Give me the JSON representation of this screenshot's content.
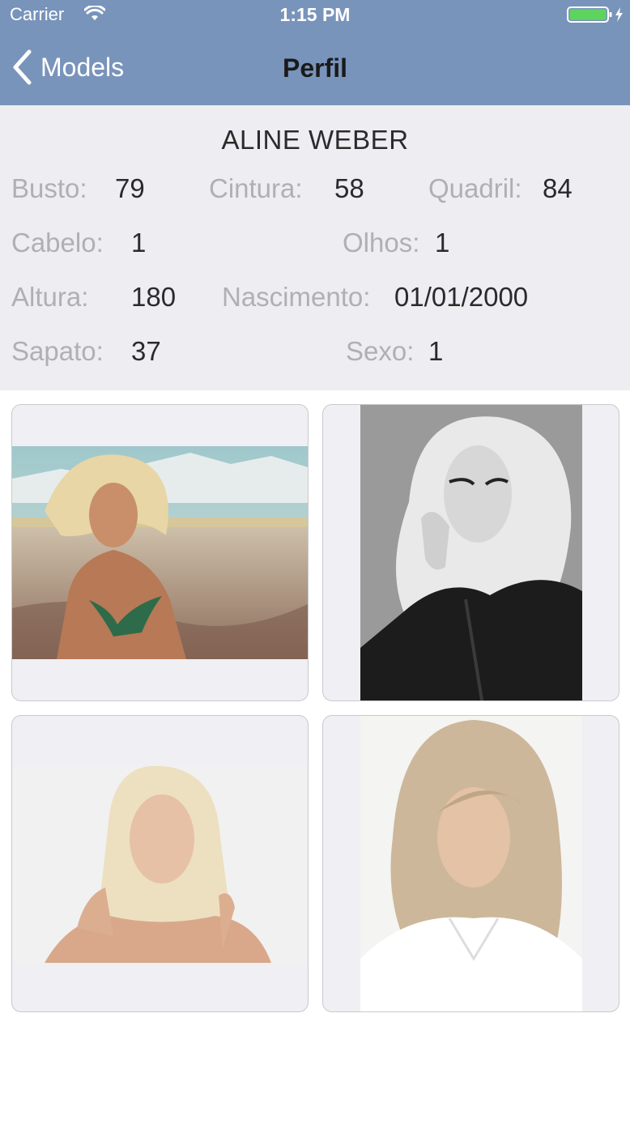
{
  "status_bar": {
    "carrier": "Carrier",
    "time": "1:15 PM"
  },
  "nav": {
    "back_label": "Models",
    "title": "Perfil"
  },
  "profile": {
    "name": "ALINE WEBER",
    "busto": {
      "label": "Busto:",
      "value": "79"
    },
    "cintura": {
      "label": "Cintura:",
      "value": "58"
    },
    "quadril": {
      "label": "Quadril:",
      "value": "84"
    },
    "cabelo": {
      "label": "Cabelo:",
      "value": "1"
    },
    "olhos": {
      "label": "Olhos:",
      "value": "1"
    },
    "altura": {
      "label": "Altura:",
      "value": "180"
    },
    "nascimento": {
      "label": "Nascimento:",
      "value": "01/01/2000"
    },
    "sapato": {
      "label": "Sapato:",
      "value": "37"
    },
    "sexo": {
      "label": "Sexo:",
      "value": "1"
    }
  },
  "gallery": {
    "photos": [
      {
        "subject": "model-beach-bikini-photo"
      },
      {
        "subject": "model-black-white-leather-jacket-photo"
      },
      {
        "subject": "model-white-background-portrait-photo"
      },
      {
        "subject": "model-white-shirt-portrait-photo"
      }
    ]
  },
  "colors": {
    "nav_bar": "#7994bb",
    "panel_background": "#eeeef2",
    "label_text": "#b0b0b4",
    "value_text": "#2a2a2a",
    "card_border": "#c9c9ce",
    "battery": "#5fd35f"
  }
}
